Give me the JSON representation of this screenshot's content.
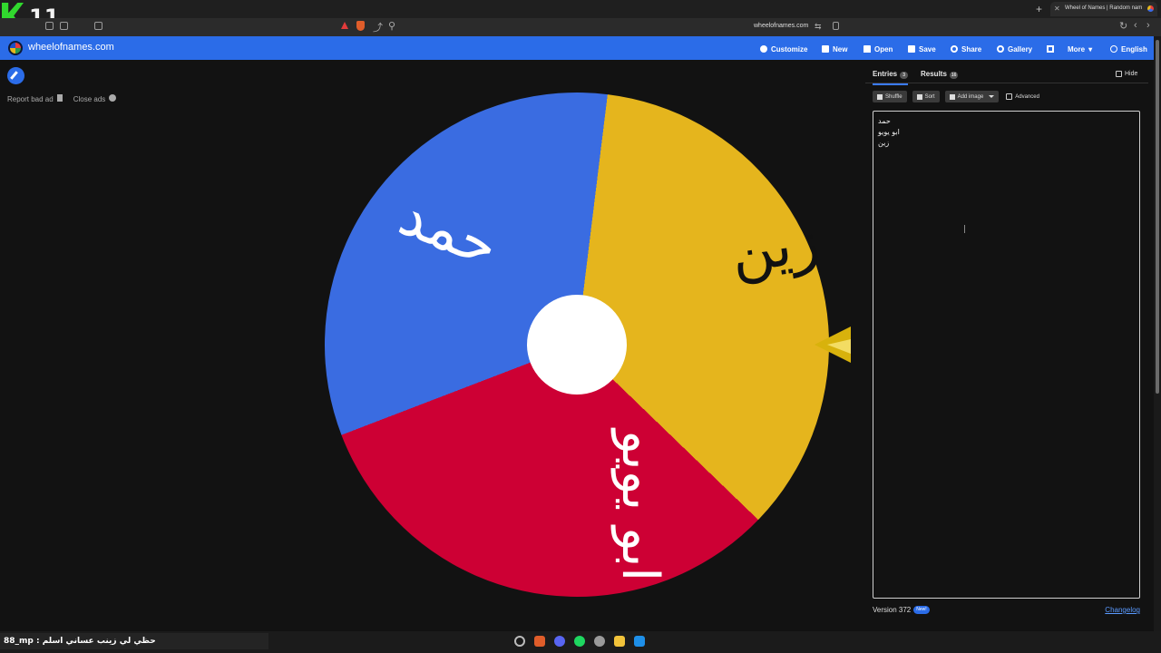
{
  "browser": {
    "overlay_number": "11",
    "active_tab_title": "Wheel of Names | Random nam",
    "url": "wheelofnames.com"
  },
  "site": {
    "brand": "wheelofnames.com",
    "menu": [
      "Customize",
      "New",
      "Open",
      "Save",
      "Share",
      "Gallery",
      "More",
      "English"
    ]
  },
  "ads": {
    "report": "Report bad ad",
    "close": "Close ads"
  },
  "wheel": {
    "entries": [
      "حمد",
      "ابو يويو",
      "زين"
    ],
    "colors": {
      "blue": "#3a6ce1",
      "yellow": "#e5b51d",
      "red": "#cd0034",
      "pointer": "#d8b20c"
    },
    "segment_labels": {
      "blue": "حمد",
      "yellow": "زين",
      "red": "ابو يويو"
    }
  },
  "panel": {
    "tabs": [
      {
        "label": "Entries",
        "count": "3"
      },
      {
        "label": "Results",
        "count": "16"
      }
    ],
    "hide_label": "Hide",
    "toolbar": {
      "shuffle": "Shuffle",
      "sort": "Sort",
      "add_image": "Add image",
      "advanced": "Advanced"
    },
    "version": "Version 372",
    "new_badge": "New!",
    "changelog": "Changelog"
  },
  "taskbar": {
    "ticker": "88_mp : حظي لي زينب عساني اسلم"
  }
}
